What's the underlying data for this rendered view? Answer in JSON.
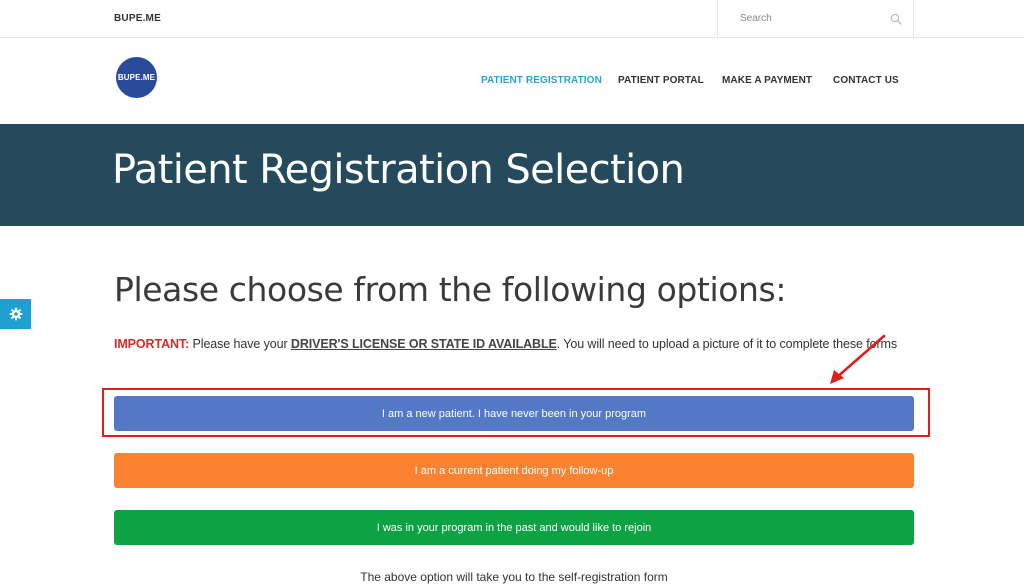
{
  "topbar": {
    "brand": "BUPE.ME",
    "search_placeholder": "Search",
    "search_icon": "search-icon"
  },
  "header": {
    "logo_text": "BUPE.ME",
    "nav": [
      {
        "label": "PATIENT REGISTRATION",
        "active": true
      },
      {
        "label": "PATIENT PORTAL",
        "active": false
      },
      {
        "label": "MAKE A PAYMENT",
        "active": false
      },
      {
        "label": "CONTACT US",
        "active": false
      }
    ]
  },
  "banner": {
    "title": "Patient Registration Selection"
  },
  "settings_tab": {
    "icon": "gear-icon"
  },
  "main": {
    "heading": "Please choose from the following options:",
    "notice": {
      "important_label": "IMPORTANT:",
      "text_before": " Please  have your ",
      "required_doc": "DRIVER'S LICENSE OR STATE ID AVAILABLE",
      "text_after": ". You will need to upload a picture of it to complete these forms"
    },
    "options": {
      "new_patient": "I am a new patient. I have never been in your program",
      "current_patient": "I am a current patient doing my follow-up",
      "rejoin": "I was in your program in the past and would like to rejoin"
    },
    "footnote": "The above option will take you to the self-registration form"
  },
  "colors": {
    "banner": "#244a5c",
    "accent_link": "#26a4d8",
    "logo": "#2b4a9a",
    "new_patient": "#5379c6",
    "current_patient": "#fb8231",
    "rejoin": "#0da243",
    "annotation": "#e51a1a",
    "important": "#d62b2b"
  }
}
